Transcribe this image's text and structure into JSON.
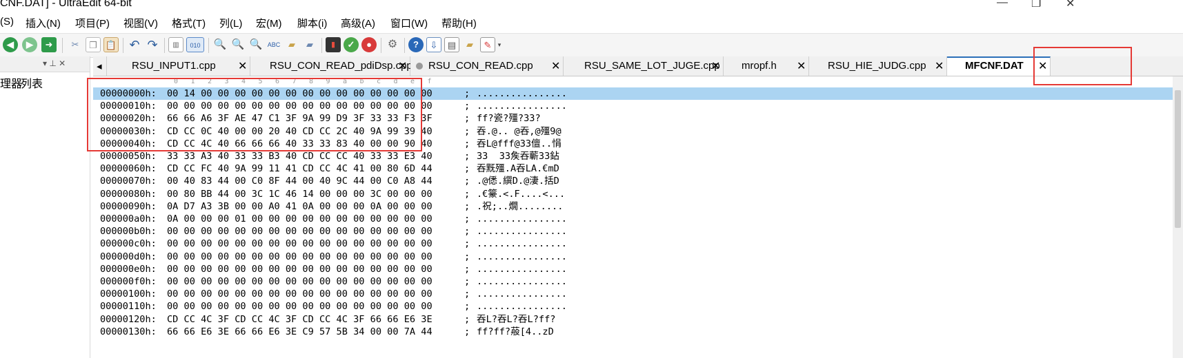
{
  "window": {
    "title": "CNF.DAT] - UltraEdit 64-bit",
    "minimize_glyph": "—",
    "restore_glyph": "❐",
    "close_glyph": "✕"
  },
  "menu": [
    "(S)",
    "插入(N)",
    "项目(P)",
    "视图(V)",
    "格式(T)",
    "列(L)",
    "宏(M)",
    "脚本(i)",
    "高级(A)",
    "窗口(W)",
    "帮助(H)"
  ],
  "toolbar": {
    "icons": [
      "back-icon",
      "forward-icon",
      "jump-icon",
      "cut-icon",
      "copy-icon",
      "paste-icon",
      "undo-icon",
      "redo-icon",
      "column-mode-icon",
      "hex-mode-icon",
      "find-icon",
      "find-next-icon",
      "replace-icon",
      "spellcheck-icon",
      "find-in-files-icon",
      "replace-in-files-icon",
      "script-icon",
      "run-macro-icon",
      "stop-macro-icon",
      "settings-icon",
      "help-icon",
      "download-icon",
      "view-icon",
      "folder-icon",
      "edit-icon"
    ],
    "hex_label": "010"
  },
  "left_panel": {
    "tabs": [
      "理器",
      "列表"
    ],
    "head_glyphs": "▾ ⊥ ✕"
  },
  "tabs": [
    {
      "label": "RSU_INPUT1.cpp",
      "modified": false,
      "active": false
    },
    {
      "label": "RSU_CON_READ_pdiDsp.cpp",
      "modified": false,
      "active": false
    },
    {
      "label": "RSU_CON_READ.cpp",
      "modified": true,
      "active": false
    },
    {
      "label": "RSU_SAME_LOT_JUGE.cpp",
      "modified": false,
      "active": false
    },
    {
      "label": "mropf.h",
      "modified": false,
      "active": false
    },
    {
      "label": "RSU_HIE_JUDG.cpp",
      "modified": false,
      "active": false
    },
    {
      "label": "MFCNF.DAT",
      "modified": false,
      "active": true
    }
  ],
  "tab_close_glyph": "✕",
  "tab_scroll_left_glyph": "◂",
  "hex": {
    "ruler": [
      "0",
      "1",
      "2",
      "3",
      "4",
      "5",
      "6",
      "7",
      "8",
      "9",
      "a",
      "b",
      "c",
      "d",
      "e",
      "f"
    ],
    "separator": ";",
    "rows": [
      {
        "offset": "00000000h:",
        "bytes": "00 14 00 00 00 00 00 00 00 00 00 00 00 00 00 00",
        "ascii": "................",
        "selected": true
      },
      {
        "offset": "00000010h:",
        "bytes": "00 00 00 00 00 00 00 00 00 00 00 00 00 00 00 00",
        "ascii": "................"
      },
      {
        "offset": "00000020h:",
        "bytes": "66 66 A6 3F AE 47 C1 3F 9A 99 D9 3F 33 33 F3 3F",
        "ascii": "ff?瓷?殭?33?"
      },
      {
        "offset": "00000030h:",
        "bytes": "CD CC 0C 40 00 00 20 40 CD CC 2C 40 9A 99 39 40",
        "ascii": "吞.@.. @吞,@殭9@"
      },
      {
        "offset": "00000040h:",
        "bytes": "CD CC 4C 40 66 66 66 40 33 33 83 40 00 00 90 40",
        "ascii": "吞L@fff@33儃..悁"
      },
      {
        "offset": "00000050h:",
        "bytes": "33 33 A3 40 33 33 B3 40 CD CC CC 40 33 33 E3 40",
        "ascii": "33  33矦吞蘄33鉆"
      },
      {
        "offset": "00000060h:",
        "bytes": "CD CC FC 40 9A 99 11 41 CD CC 4C 41 00 80 6D 44",
        "ascii": "吞黖殭.A吞LA.€mD"
      },
      {
        "offset": "00000070h:",
        "bytes": "00 40 83 44 00 C0 8F 44 00 40 9C 44 00 C0 A8 44",
        "ascii": ".@僁.繏D.@淒.括D"
      },
      {
        "offset": "00000080h:",
        "bytes": "00 80 BB 44 00 3C 1C 46 14 00 00 00 3C 00 00 00",
        "ascii": ".€籇.<.F....<..."
      },
      {
        "offset": "00000090h:",
        "bytes": "0A D7 A3 3B 00 00 A0 41 0A 00 00 00 0A 00 00 00",
        "ascii": ".祝;..燗........"
      },
      {
        "offset": "000000a0h:",
        "bytes": "0A 00 00 00 01 00 00 00 00 00 00 00 00 00 00 00",
        "ascii": "................"
      },
      {
        "offset": "000000b0h:",
        "bytes": "00 00 00 00 00 00 00 00 00 00 00 00 00 00 00 00",
        "ascii": "................"
      },
      {
        "offset": "000000c0h:",
        "bytes": "00 00 00 00 00 00 00 00 00 00 00 00 00 00 00 00",
        "ascii": "................"
      },
      {
        "offset": "000000d0h:",
        "bytes": "00 00 00 00 00 00 00 00 00 00 00 00 00 00 00 00",
        "ascii": "................"
      },
      {
        "offset": "000000e0h:",
        "bytes": "00 00 00 00 00 00 00 00 00 00 00 00 00 00 00 00",
        "ascii": "................"
      },
      {
        "offset": "000000f0h:",
        "bytes": "00 00 00 00 00 00 00 00 00 00 00 00 00 00 00 00",
        "ascii": "................"
      },
      {
        "offset": "00000100h:",
        "bytes": "00 00 00 00 00 00 00 00 00 00 00 00 00 00 00 00",
        "ascii": "................"
      },
      {
        "offset": "00000110h:",
        "bytes": "00 00 00 00 00 00 00 00 00 00 00 00 00 00 00 00",
        "ascii": "................"
      },
      {
        "offset": "00000120h:",
        "bytes": "CD CC 4C 3F CD CC 4C 3F CD CC 4C 3F 66 66 E6 3E",
        "ascii": "吞L?吞L?吞L?ff?"
      },
      {
        "offset": "00000130h:",
        "bytes": "66 66 E6 3E 66 66 E6 3E C9 57 5B 34 00 00 7A 44",
        "ascii": "ff?ff?蒰[4..zD"
      }
    ]
  },
  "colors": {
    "selection": "#abd4f2",
    "annotation": "#e53935",
    "active_tab_accent": "#2b6fb8"
  }
}
